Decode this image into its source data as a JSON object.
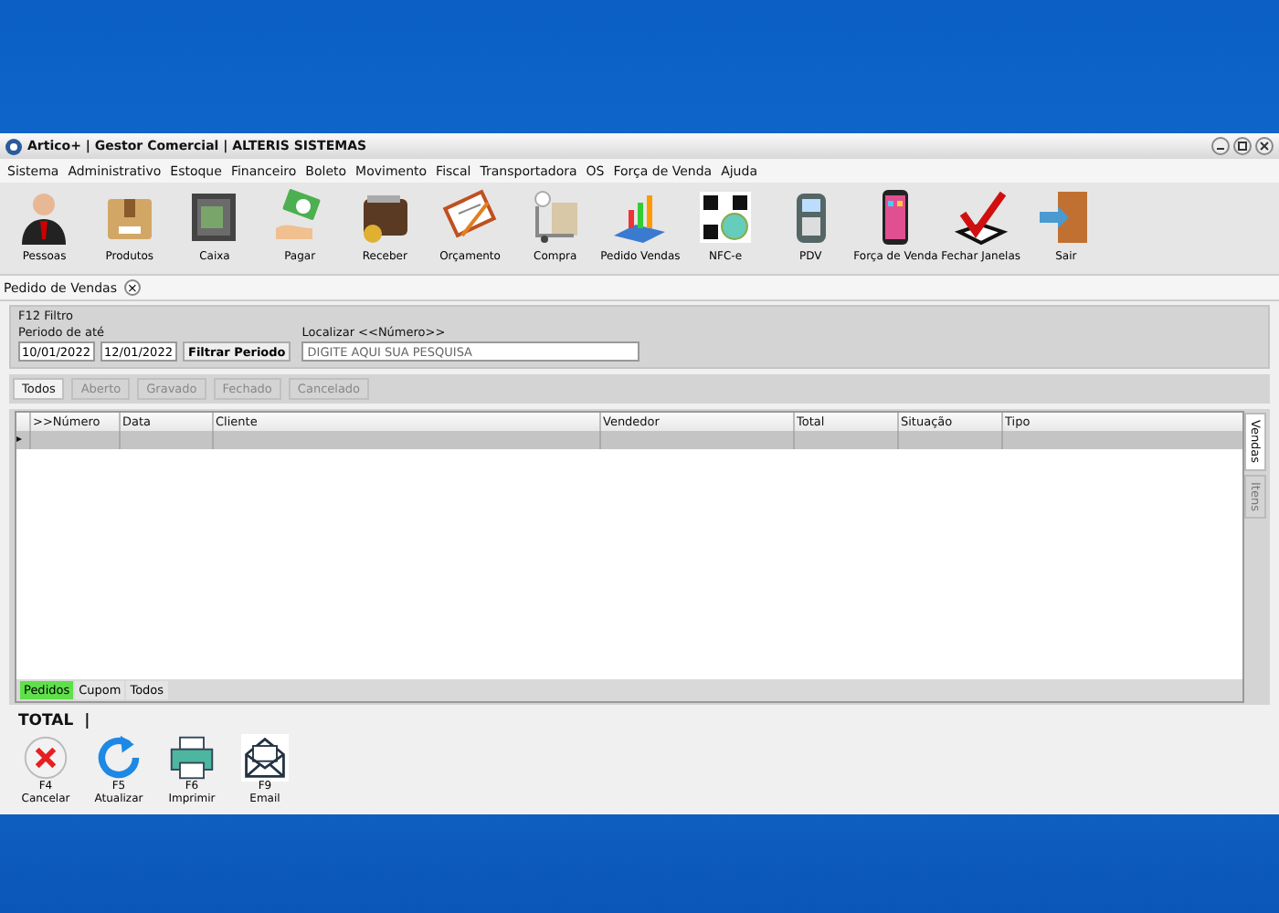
{
  "window": {
    "title": "Artico+ | Gestor Comercial | ALTERIS SISTEMAS"
  },
  "menu": [
    "Sistema",
    "Administrativo",
    "Estoque",
    "Financeiro",
    "Boleto",
    "Movimento",
    "Fiscal",
    "Transportadora",
    "OS",
    "Força de Venda",
    "Ajuda"
  ],
  "toolbar": [
    {
      "label": "Pessoas",
      "kind": "person"
    },
    {
      "label": "Produtos",
      "kind": "box"
    },
    {
      "label": "Caixa",
      "kind": "safe"
    },
    {
      "label": "Pagar",
      "kind": "money"
    },
    {
      "label": "Receber",
      "kind": "wallet"
    },
    {
      "label": "Orçamento",
      "kind": "clipboard"
    },
    {
      "label": "Compra",
      "kind": "cart"
    },
    {
      "label": "Pedido Vendas",
      "kind": "chart"
    },
    {
      "label": "NFC-e",
      "kind": "qr"
    },
    {
      "label": "PDV",
      "kind": "terminal"
    },
    {
      "label": "Força de Venda",
      "kind": "phone"
    },
    {
      "label": "Fechar Janelas",
      "kind": "check"
    },
    {
      "label": "Sair",
      "kind": "door"
    }
  ],
  "document_tab": {
    "label": "Pedido de Vendas",
    "close": "×"
  },
  "filter": {
    "title": "F12 Filtro",
    "period_label": "Periodo de  até",
    "date_from": "10/01/2022",
    "date_to": "12/01/2022",
    "filter_button": "Filtrar Periodo",
    "search_label": "Localizar <<Número>>",
    "search_placeholder": "DIGITE AQUI SUA PESQUISA"
  },
  "status_tabs": [
    {
      "label": "Todos",
      "selected": true
    },
    {
      "label": "Aberto",
      "selected": false
    },
    {
      "label": "Gravado",
      "selected": false
    },
    {
      "label": "Fechado",
      "selected": false
    },
    {
      "label": "Cancelado",
      "selected": false
    }
  ],
  "table": {
    "columns": [
      ">>Número",
      "Data",
      "Cliente",
      "Vendedor",
      "Total",
      "Situação",
      "Tipo"
    ],
    "row_indicator": "▸"
  },
  "side_tabs": [
    {
      "label": "Vendas",
      "selected": true
    },
    {
      "label": "Itens",
      "selected": false
    }
  ],
  "bottom_tabs": [
    {
      "label": "Pedidos",
      "selected": true
    },
    {
      "label": "Cupom",
      "selected": false
    },
    {
      "label": "Todos",
      "selected": false
    }
  ],
  "total_label": "TOTAL  |",
  "actions": [
    {
      "key": "F4",
      "label": "Cancelar",
      "kind": "cancel"
    },
    {
      "key": "F5",
      "label": "Atualizar",
      "kind": "refresh"
    },
    {
      "key": "F6",
      "label": "Imprimir",
      "kind": "print"
    },
    {
      "key": "F9",
      "label": "Email",
      "kind": "email"
    }
  ]
}
